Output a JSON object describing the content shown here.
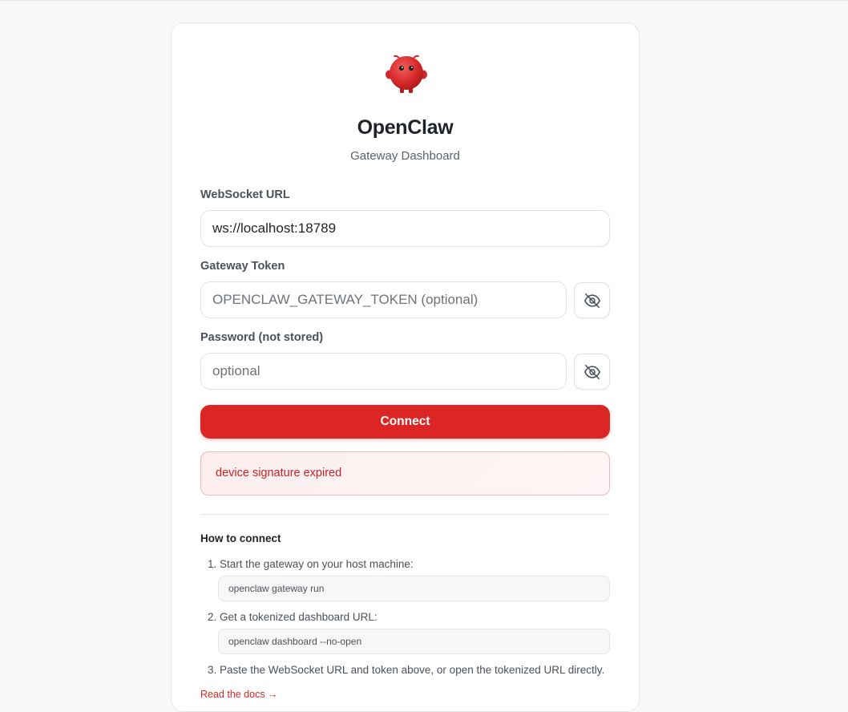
{
  "app": {
    "title": "OpenClaw",
    "subtitle": "Gateway Dashboard",
    "logo_icon": "red-crab-mascot-icon"
  },
  "form": {
    "websocket": {
      "label": "WebSocket URL",
      "value": "ws://localhost:18789"
    },
    "token": {
      "label": "Gateway Token",
      "placeholder": "OPENCLAW_GATEWAY_TOKEN (optional)",
      "toggle_icon": "eye-off-icon"
    },
    "password": {
      "label": "Password (not stored)",
      "placeholder": "optional",
      "toggle_icon": "eye-off-icon"
    },
    "connect_label": "Connect"
  },
  "error": {
    "message": "device signature expired"
  },
  "howto": {
    "title": "How to connect",
    "steps": [
      {
        "text": "1. Start the gateway on your host machine:",
        "code": "openclaw gateway run"
      },
      {
        "text": "2. Get a tokenized dashboard URL:",
        "code": "openclaw dashboard --no-open"
      },
      {
        "text": "3. Paste the WebSocket URL and token above, or open the tokenized URL directly."
      }
    ],
    "docs_link": "Read the docs →"
  },
  "colors": {
    "accent": "#dc2626",
    "error_text": "#c42323",
    "error_bg": "#fdeeee",
    "error_border": "#f2b8b8"
  }
}
